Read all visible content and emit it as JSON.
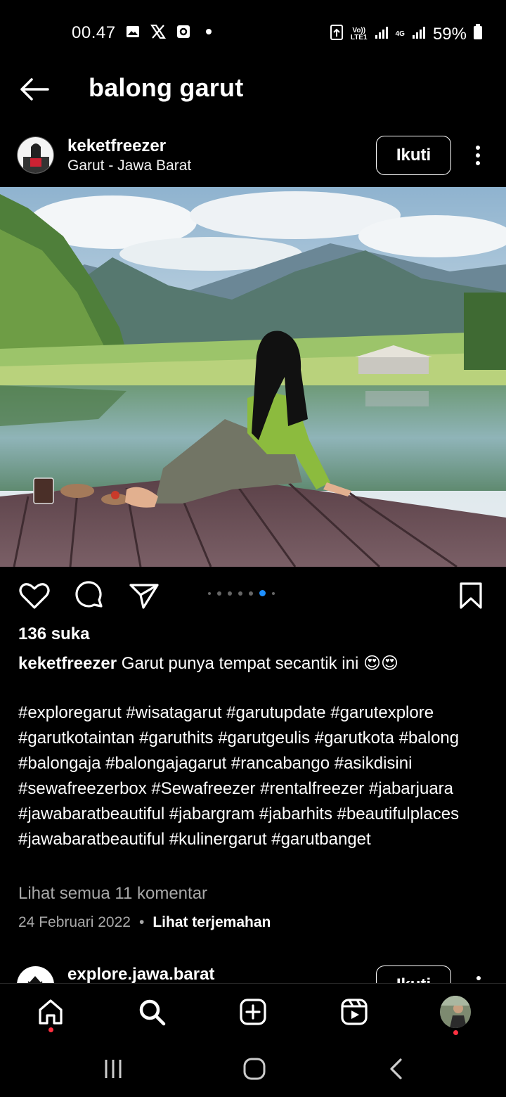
{
  "status_bar": {
    "time": "00.47",
    "icons": [
      "gallery-icon",
      "x-icon",
      "app-icon",
      "dot-icon"
    ],
    "volte_label": "Vo))\nLTE1",
    "network_label": "4G",
    "battery": "59%"
  },
  "header": {
    "title": "balong garut"
  },
  "post": {
    "username": "keketfreezer",
    "location": "Garut - Jawa Barat",
    "follow_label": "Ikuti",
    "likes": "136 suka",
    "caption_user": "keketfreezer",
    "caption_text": "Garut punya tempat secantik ini 😍😍",
    "hashtags": "#exploregarut #wisatagarut #garutupdate #garutexplore #garutkotaintan #garuthits #garutgeulis #garutkota #balong #balongaja #balongajagarut #rancabango #asikdisini #sewafreezerbox #Sewafreezer #rentalfreezer #jabarjuara #jawabaratbeautiful #jabargram #jabarhits #beautifulplaces #jawabaratbeautiful #kulinergarut #garutbanget",
    "view_comments": "Lihat semua 11 komentar",
    "date": "24 Februari 2022",
    "separator": "•",
    "translate": "Lihat terjemahan",
    "carousel": {
      "count": 7,
      "active_index": 6
    }
  },
  "next_post": {
    "username": "explore.jawa.barat",
    "follow_label": "Ikuti"
  },
  "colors": {
    "background": "#000000",
    "accent_blue": "#1e90ff",
    "muted_text": "#a8a8a8",
    "notification_red": "#ff3040"
  }
}
